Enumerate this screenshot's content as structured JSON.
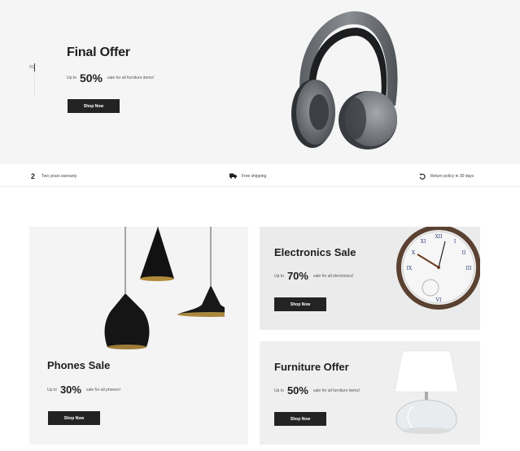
{
  "hero": {
    "slide_number": "01",
    "title": "Final Offer",
    "upto": "Up to",
    "percent": "50%",
    "description": "sale for all furniture items!",
    "button": "Shop Now",
    "image_icon": "headphones-icon"
  },
  "features": [
    {
      "icon": "warranty-2-icon",
      "icon_text": "2",
      "label": "Two years warranty"
    },
    {
      "icon": "truck-icon",
      "label": "Free shipping"
    },
    {
      "icon": "return-icon",
      "label": "Return policy in 30 days"
    }
  ],
  "cards": {
    "phones": {
      "title": "Phones Sale",
      "upto": "Up to",
      "percent": "30%",
      "description": "sale for all phones!",
      "button": "Shop Now",
      "image_icon": "pendant-lamps-icon"
    },
    "electronics": {
      "title": "Electronics Sale",
      "upto": "Up to",
      "percent": "70%",
      "description": "sale for all electronics!",
      "button": "Shop Now",
      "image_icon": "wall-clock-icon"
    },
    "furniture": {
      "title": "Furniture Offer",
      "upto": "Up to",
      "percent": "50%",
      "description": "sale for all furniture items!",
      "button": "Shop Now",
      "image_icon": "table-lamp-icon"
    }
  },
  "colors": {
    "accent": "#232323",
    "hero_bg": "#f5f5f6",
    "card_bg": "#f4f4f5"
  }
}
